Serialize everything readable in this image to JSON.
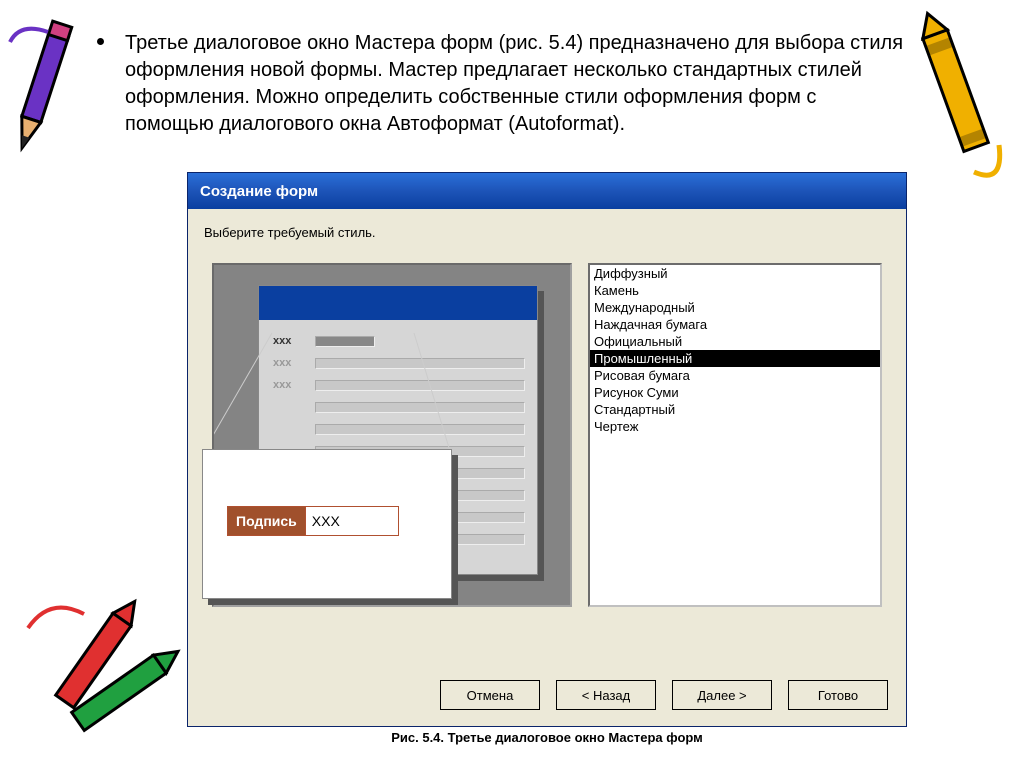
{
  "slide": {
    "bullet_text": "Третье диалоговое окно Мастера форм (рис. 5.4)  предназначено для выбора стиля оформления новой формы. Мастер предлагает несколько стандартных стилей оформления. Можно определить собственные стили оформления форм с помощью диалогового окна Автоформат (Autoformat).",
    "caption": "Рис. 5.4. Третье диалоговое окно Мастера форм"
  },
  "dialog": {
    "title": "Создание форм",
    "prompt": "Выберите требуемый стиль.",
    "preview": {
      "label_text": "Подпись",
      "field_text": "XXX",
      "row_placeholder": "xxx"
    },
    "styles": [
      "Диффузный",
      "Камень",
      "Международный",
      "Наждачная бумага",
      "Официальный",
      "Промышленный",
      "Рисовая бумага",
      "Рисунок Суми",
      "Стандартный",
      "Чертеж"
    ],
    "selected_index": 5,
    "buttons": {
      "cancel": "Отмена",
      "back": "< Назад",
      "next": "Далее >",
      "finish": "Готово"
    }
  }
}
